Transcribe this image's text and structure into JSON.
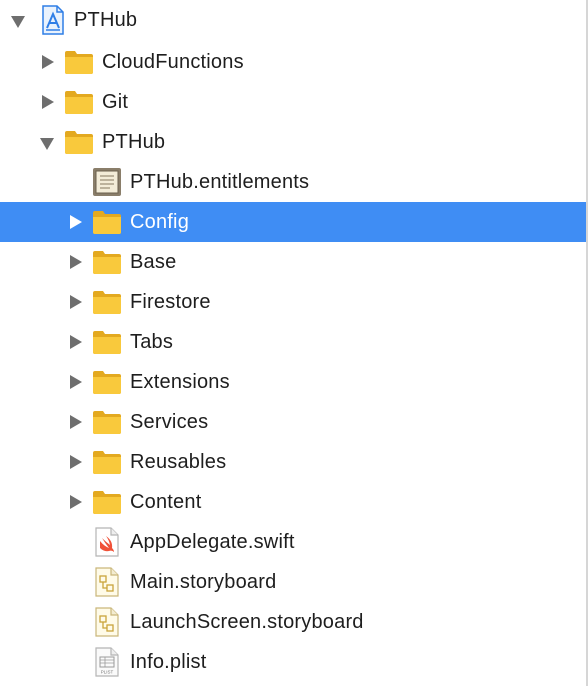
{
  "navigator": {
    "items": [
      {
        "label": "PTHub",
        "kind": "project",
        "icon": "xcode-project-icon",
        "disclosure": "expanded",
        "depth": 0,
        "selected": false
      },
      {
        "label": "CloudFunctions",
        "kind": "folder",
        "icon": "folder-icon",
        "disclosure": "collapsed",
        "depth": 1,
        "selected": false
      },
      {
        "label": "Git",
        "kind": "folder",
        "icon": "folder-icon",
        "disclosure": "collapsed",
        "depth": 1,
        "selected": false
      },
      {
        "label": "PTHub",
        "kind": "folder",
        "icon": "folder-icon",
        "disclosure": "expanded",
        "depth": 1,
        "selected": false
      },
      {
        "label": "PTHub.entitlements",
        "kind": "entitlements",
        "icon": "entitlements-file-icon",
        "disclosure": "none",
        "depth": 2,
        "selected": false
      },
      {
        "label": "Config",
        "kind": "folder",
        "icon": "folder-icon",
        "disclosure": "collapsed",
        "depth": 2,
        "selected": true
      },
      {
        "label": "Base",
        "kind": "folder",
        "icon": "folder-icon",
        "disclosure": "collapsed",
        "depth": 2,
        "selected": false
      },
      {
        "label": "Firestore",
        "kind": "folder",
        "icon": "folder-icon",
        "disclosure": "collapsed",
        "depth": 2,
        "selected": false
      },
      {
        "label": "Tabs",
        "kind": "folder",
        "icon": "folder-icon",
        "disclosure": "collapsed",
        "depth": 2,
        "selected": false
      },
      {
        "label": "Extensions",
        "kind": "folder",
        "icon": "folder-icon",
        "disclosure": "collapsed",
        "depth": 2,
        "selected": false
      },
      {
        "label": "Services",
        "kind": "folder",
        "icon": "folder-icon",
        "disclosure": "collapsed",
        "depth": 2,
        "selected": false
      },
      {
        "label": "Reusables",
        "kind": "folder",
        "icon": "folder-icon",
        "disclosure": "collapsed",
        "depth": 2,
        "selected": false
      },
      {
        "label": "Content",
        "kind": "folder",
        "icon": "folder-icon",
        "disclosure": "collapsed",
        "depth": 2,
        "selected": false
      },
      {
        "label": "AppDelegate.swift",
        "kind": "swift",
        "icon": "swift-file-icon",
        "disclosure": "none",
        "depth": 2,
        "selected": false
      },
      {
        "label": "Main.storyboard",
        "kind": "storyboard",
        "icon": "storyboard-file-icon",
        "disclosure": "none",
        "depth": 2,
        "selected": false
      },
      {
        "label": "LaunchScreen.storyboard",
        "kind": "storyboard",
        "icon": "storyboard-file-icon",
        "disclosure": "none",
        "depth": 2,
        "selected": false
      },
      {
        "label": "Info.plist",
        "kind": "plist",
        "icon": "plist-file-icon",
        "disclosure": "none",
        "depth": 2,
        "selected": false,
        "icon_text": "PLIST"
      }
    ]
  },
  "colors": {
    "selection": "#3f8df4",
    "folder": "#f9c93c",
    "project": "#2f7ee6",
    "swift": "#f05138"
  }
}
